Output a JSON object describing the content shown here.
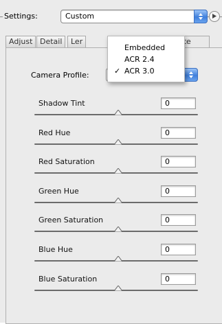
{
  "settings": {
    "label": "Settings:",
    "value": "Custom"
  },
  "tabs": [
    {
      "label": "Adjust"
    },
    {
      "label": "Detail"
    },
    {
      "label": "Ler"
    },
    {
      "label": "ate"
    }
  ],
  "camera_profile": {
    "label": "Camera Profile:"
  },
  "popup_menu": {
    "items": [
      {
        "label": "Embedded",
        "checked": false
      },
      {
        "label": "ACR 2.4",
        "checked": false
      },
      {
        "label": "ACR 3.0",
        "checked": true,
        "check_mark": "✓"
      }
    ]
  },
  "sliders": [
    {
      "label": "Shadow Tint",
      "value": "0"
    },
    {
      "label": "Red Hue",
      "value": "0"
    },
    {
      "label": "Red Saturation",
      "value": "0"
    },
    {
      "label": "Green Hue",
      "value": "0"
    },
    {
      "label": "Green Saturation",
      "value": "0"
    },
    {
      "label": "Blue Hue",
      "value": "0"
    },
    {
      "label": "Blue Saturation",
      "value": "0"
    }
  ],
  "colors": {
    "accent": "#3f7fdc",
    "panel_bg": "#ebebeb"
  }
}
